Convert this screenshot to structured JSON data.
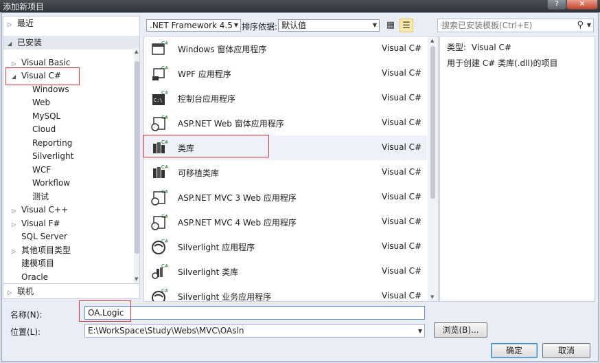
{
  "window": {
    "title": "添加新项目",
    "help_label": "?",
    "close_label": "✕"
  },
  "tree": {
    "recent_label": "最近",
    "installed_label": "已安装",
    "online_label": "联机",
    "items": [
      {
        "label": "Visual Basic"
      },
      {
        "label": "Visual C#"
      },
      {
        "label": "Windows"
      },
      {
        "label": "Web"
      },
      {
        "label": "MySQL"
      },
      {
        "label": "Cloud"
      },
      {
        "label": "Reporting"
      },
      {
        "label": "Silverlight"
      },
      {
        "label": "WCF"
      },
      {
        "label": "Workflow"
      },
      {
        "label": "测试"
      },
      {
        "label": "Visual C++"
      },
      {
        "label": "Visual F#"
      },
      {
        "label": "SQL Server"
      },
      {
        "label": "其他项目类型"
      },
      {
        "label": "建模项目"
      },
      {
        "label": "Oracle"
      }
    ]
  },
  "toolbar": {
    "framework_value": ".NET Framework 4.5",
    "sort_label": "排序依据:",
    "sort_value": "默认值"
  },
  "search": {
    "placeholder": "搜索已安装模板(Ctrl+E)"
  },
  "templates": [
    {
      "name": "Windows 窗体应用程序",
      "lang": "Visual C#",
      "icon": "windows-forms-icon"
    },
    {
      "name": "WPF 应用程序",
      "lang": "Visual C#",
      "icon": "wpf-icon"
    },
    {
      "name": "控制台应用程序",
      "lang": "Visual C#",
      "icon": "console-icon"
    },
    {
      "name": "ASP.NET Web 窗体应用程序",
      "lang": "Visual C#",
      "icon": "web-forms-icon"
    },
    {
      "name": "类库",
      "lang": "Visual C#",
      "icon": "class-library-icon"
    },
    {
      "name": "可移植类库",
      "lang": "Visual C#",
      "icon": "portable-library-icon"
    },
    {
      "name": "ASP.NET MVC 3 Web 应用程序",
      "lang": "Visual C#",
      "icon": "mvc3-icon"
    },
    {
      "name": "ASP.NET MVC 4 Web 应用程序",
      "lang": "Visual C#",
      "icon": "mvc4-icon"
    },
    {
      "name": "Silverlight 应用程序",
      "lang": "Visual C#",
      "icon": "silverlight-app-icon"
    },
    {
      "name": "Silverlight 类库",
      "lang": "Visual C#",
      "icon": "silverlight-library-icon"
    },
    {
      "name": "Silverlight 业务应用程序",
      "lang": "Visual C#",
      "icon": "silverlight-business-icon"
    }
  ],
  "info": {
    "type_label": "类型:",
    "type_value": "Visual C#",
    "description": "用于创建 C# 类库(.dll)的项目"
  },
  "form": {
    "name_label": "名称(N):",
    "name_value": "OA.Logic",
    "location_label": "位置(L):",
    "location_value": "E:\\WorkSpace\\Study\\Webs\\MVC\\OAsln",
    "browse_label": "浏览(B)...",
    "ok_label": "确定",
    "cancel_label": "取消"
  },
  "colors": {
    "highlight": "#e0333a",
    "dialog_bg": "#e9edf5",
    "titlebar": "#3a3e44"
  }
}
